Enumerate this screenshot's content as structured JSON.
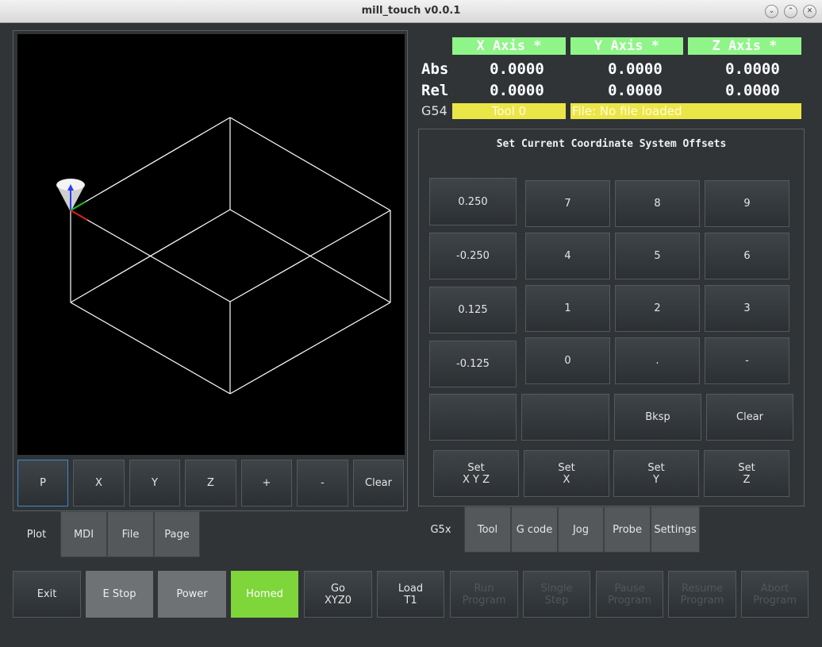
{
  "window": {
    "title": "mill_touch v0.0.1"
  },
  "plot": {
    "view_buttons": [
      "P",
      "X",
      "Y",
      "Z",
      "+",
      "-",
      "Clear"
    ]
  },
  "left_tabs": [
    "Plot",
    "MDI",
    "File",
    "Page"
  ],
  "dro": {
    "headers": [
      "X Axis *",
      "Y Axis *",
      "Z Axis *"
    ],
    "abs_label": "Abs",
    "rel_label": "Rel",
    "abs_values": [
      "0.0000",
      "0.0000",
      "0.0000"
    ],
    "rel_values": [
      "0.0000",
      "0.0000",
      "0.0000"
    ],
    "coord_system": "G54",
    "tool": "Tool 0",
    "file": "File: No file loaded"
  },
  "offsets": {
    "title": "Set Current Coordinate System Offsets",
    "increments": [
      "0.250",
      "-0.250",
      "0.125",
      "-0.125"
    ],
    "keypad": [
      "7",
      "8",
      "9",
      "4",
      "5",
      "6",
      "1",
      "2",
      "3",
      "0",
      ".",
      "-"
    ],
    "bksp": "Bksp",
    "clear": "Clear",
    "set_buttons": [
      {
        "l1": "Set",
        "l2": "X Y Z"
      },
      {
        "l1": "Set",
        "l2": "X"
      },
      {
        "l1": "Set",
        "l2": "Y"
      },
      {
        "l1": "Set",
        "l2": "Z"
      }
    ]
  },
  "right_tabs": [
    "G5x",
    "Tool",
    "G code",
    "Jog",
    "Probe",
    "Settings"
  ],
  "bottom": {
    "exit": "Exit",
    "estop": "E Stop",
    "power": "Power",
    "homed": "Homed",
    "go": {
      "l1": "Go",
      "l2": "XYZ0"
    },
    "load": {
      "l1": "Load",
      "l2": "T1"
    },
    "run": {
      "l1": "Run",
      "l2": "Program"
    },
    "single": {
      "l1": "Single",
      "l2": "Step"
    },
    "pause": {
      "l1": "Pause",
      "l2": "Program"
    },
    "resume": {
      "l1": "Resume",
      "l2": "Program"
    },
    "abort": {
      "l1": "Abort",
      "l2": "Program"
    }
  },
  "colors": {
    "axis_header": "#8ff588",
    "status_yellow": "#ebe648",
    "homed_green": "#7ed63a",
    "background": "#303437"
  }
}
